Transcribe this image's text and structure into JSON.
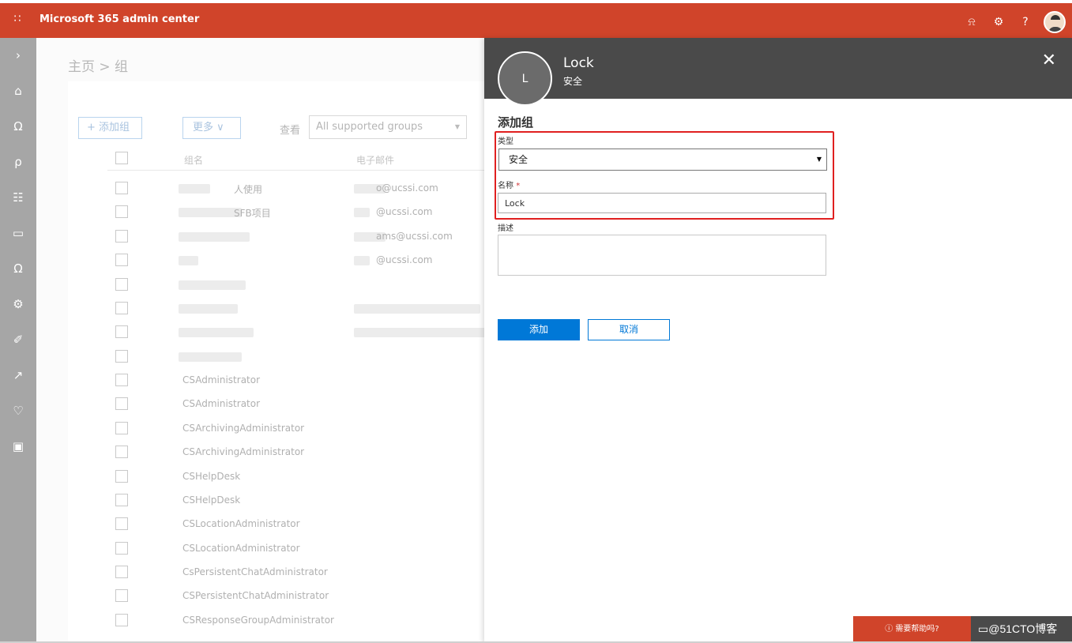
{
  "header": {
    "app_title": "Microsoft 365 admin center",
    "waffle_icon": "∷",
    "notification_icon": "⍾",
    "settings_icon": "⚙",
    "help_icon": "?"
  },
  "leftnav": {
    "items": [
      {
        "icon": "chevron-right",
        "glyph": "›"
      },
      {
        "icon": "home",
        "glyph": "⌂"
      },
      {
        "icon": "user",
        "glyph": "Ω"
      },
      {
        "icon": "groups",
        "glyph": "ρ"
      },
      {
        "icon": "resources",
        "glyph": "☷"
      },
      {
        "icon": "billing",
        "glyph": "▭"
      },
      {
        "icon": "support",
        "glyph": "Ω"
      },
      {
        "icon": "settings",
        "glyph": "⚙"
      },
      {
        "icon": "setup",
        "glyph": "✐"
      },
      {
        "icon": "reports",
        "glyph": "↗"
      },
      {
        "icon": "health",
        "glyph": "♡"
      },
      {
        "icon": "admin-centers",
        "glyph": "▣"
      }
    ]
  },
  "main": {
    "breadcrumb": "主页 > 组",
    "add_group_label": "+ 添加组",
    "more_label": "更多 ∨",
    "view_label": "查看",
    "view_select_value": "All supported groups",
    "columns": [
      "组名",
      "电子邮件"
    ],
    "rows": [
      {
        "name": "人使用",
        "email": "o@ucssi.com"
      },
      {
        "name": "SFB项目",
        "email": "@ucssi.com"
      },
      {
        "name": "",
        "email": "ams@ucssi.com"
      },
      {
        "name": "",
        "email": "@ucssi.com"
      },
      {
        "name": "",
        "email": ""
      },
      {
        "name": "",
        "email": ""
      },
      {
        "name": "",
        "email": ""
      },
      {
        "name": "",
        "email": ""
      },
      {
        "name": "CSAdministrator",
        "email": ""
      },
      {
        "name": "CSAdministrator",
        "email": ""
      },
      {
        "name": "CSArchivingAdministrator",
        "email": ""
      },
      {
        "name": "CSArchivingAdministrator",
        "email": ""
      },
      {
        "name": "CSHelpDesk",
        "email": ""
      },
      {
        "name": "CSHelpDesk",
        "email": ""
      },
      {
        "name": "CSLocationAdministrator",
        "email": ""
      },
      {
        "name": "CSLocationAdministrator",
        "email": ""
      },
      {
        "name": "CsPersistentChatAdministrator",
        "email": ""
      },
      {
        "name": "CSPersistentChatAdministrator",
        "email": ""
      },
      {
        "name": "CSResponseGroupAdministrator",
        "email": ""
      }
    ]
  },
  "panel": {
    "avatar_initial": "L",
    "title": "Lock",
    "subtitle": "安全",
    "close_icon": "✕",
    "section_title": "添加组",
    "type_label": "类型",
    "type_value": "安全",
    "name_label": "名称",
    "required_mark": "*",
    "name_value": "Lock",
    "description_label": "描述",
    "description_value": "",
    "add_button": "添加",
    "cancel_button": "取消"
  },
  "footer": {
    "help_button": "ⓘ 需要帮助吗?",
    "watermark": "▭@51CTO博客"
  },
  "colors": {
    "brand": "#d0442a",
    "primary": "#0078d7",
    "panel_header": "#4a4a4a",
    "highlight": "#e02020"
  }
}
